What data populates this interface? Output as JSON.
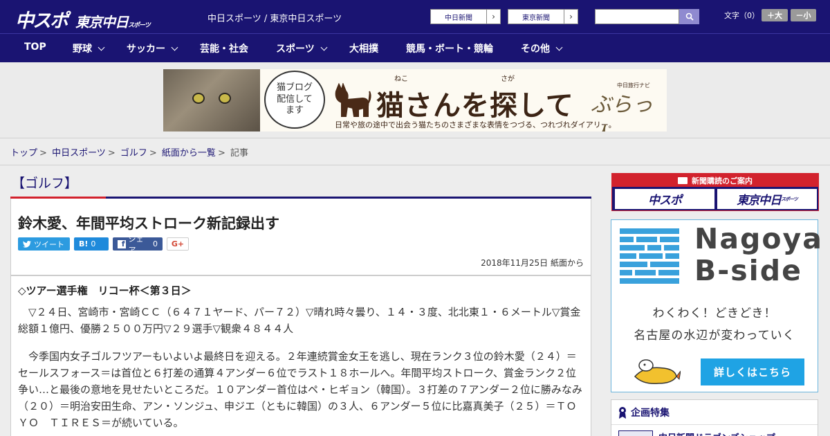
{
  "header": {
    "logo_main": "中スポ",
    "logo_tokyo": "東京中日",
    "logo_tokyo_small": "スポーツ",
    "site_names": "中日スポーツ / 東京中日スポーツ",
    "ext_links": [
      "中日新聞",
      "東京新聞"
    ],
    "search_placeholder": "",
    "font_size_label": "文字（0）",
    "font_bigger": "＋大",
    "font_smaller": "－小"
  },
  "nav": {
    "items": [
      {
        "label": "TOP",
        "dropdown": false
      },
      {
        "label": "野球",
        "dropdown": true
      },
      {
        "label": "サッカー",
        "dropdown": true
      },
      {
        "label": "芸能・社会",
        "dropdown": false
      },
      {
        "label": "スポーツ",
        "dropdown": true
      },
      {
        "label": "大相撲",
        "dropdown": false
      },
      {
        "label": "競馬・ボート・競輪",
        "dropdown": false
      },
      {
        "label": "その他",
        "dropdown": true
      }
    ]
  },
  "banner": {
    "bubble": "猫ブログ\n配信して\nます",
    "title": "猫さんを探して",
    "ruby_neko": "ねこ",
    "ruby_saga": "さが",
    "subtitle": "日常や旅の途中で出会う猫たちのさまざまな表情をつづる、つれづれダイアリー。",
    "brand": "ぶらっ人",
    "brand_small": "中日旅行ナビ"
  },
  "breadcrumb": [
    {
      "label": "トップ",
      "link": true
    },
    {
      "label": "中日スポーツ",
      "link": true
    },
    {
      "label": "ゴルフ",
      "link": true
    },
    {
      "label": "紙面から一覧",
      "link": true
    },
    {
      "label": "記事",
      "link": false
    }
  ],
  "article": {
    "category": "【ゴルフ】",
    "title": "鈴木愛、年間平均ストローク新記録出す",
    "share": {
      "tweet": "ツイート",
      "hatena": "B!",
      "hatena_count": "0",
      "facebook": "シェア",
      "facebook_count": "0",
      "gplus": "G+"
    },
    "date": "2018年11月25日 紙面から",
    "subhead": "◇ツアー選手権　リコー杯＜第３日＞",
    "para1": "　▽２４日、宮崎市・宮崎ＣＣ（６４７１ヤード、パー７２）▽晴れ時々曇り、１４・３度、北北東１・６メートル▽賞金総額１億円、優勝２５００万円▽２９選手▽観衆４８４４人",
    "para2": "　今季国内女子ゴルフツアーもいよいよ最終日を迎える。２年連続賞金女王を逃し、現在ランク３位の鈴木愛（２４）＝セールスフォース＝は首位と６打差の通算４アンダー６位でラスト１８ホールへ。年間平均ストローク、賞金ランク２位争い…と最後の意地を見せたいところだ。１０アンダー首位はペ・ヒギョン（韓国）。３打差の７アンダー２位に勝みなみ（２０）＝明治安田生命、アン・ソンジュ、申ジエ（ともに韓国）の３人、６アンダー５位に比嘉真美子（２５）＝ＴＯＹＯ　ＴＩＲＥＳ＝が続いている。"
  },
  "sidebar": {
    "subscribe_header": "新聞購読のご案内",
    "subscribe_logos": [
      "中スポ",
      "東京中日"
    ],
    "subscribe_logo_small": "スポーツ",
    "bside_title_1": "Nagoya",
    "bside_title_2": "B-side",
    "bside_tag1": "わくわく！どきどき！",
    "bside_tag2": "名古屋の水辺が変わっていく",
    "bside_button": "詳しくはこちら",
    "kikaku_title": "企画特集",
    "kikaku_item": "中日新聞ドラゴンズショップ"
  },
  "colors": {
    "brand_navy": "#1a1472",
    "accent_red": "#d2222d",
    "bside_blue": "#1fa3e4"
  }
}
